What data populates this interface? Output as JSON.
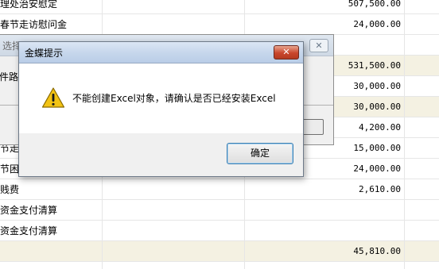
{
  "grid": {
    "rows": [
      {
        "name": "理处治安慰定",
        "amount": "507,500.00",
        "highlight": false
      },
      {
        "name": "春节走访慰问金",
        "amount": "24,000.00",
        "highlight": false
      },
      {
        "name": "",
        "amount": "",
        "highlight": false
      },
      {
        "name": "",
        "amount": "531,500.00",
        "highlight": true
      },
      {
        "name": "",
        "amount": "30,000.00",
        "highlight": false
      },
      {
        "name": "",
        "amount": "30,000.00",
        "highlight": true
      },
      {
        "name": "",
        "amount": "4,200.00",
        "highlight": false
      },
      {
        "name": "节走",
        "amount": "15,000.00",
        "highlight": false
      },
      {
        "name": "节困",
        "amount": "24,000.00",
        "highlight": false
      },
      {
        "name": "贱费",
        "amount": "2,610.00",
        "highlight": false
      },
      {
        "name": "资金支付清算",
        "amount": "",
        "highlight": false
      },
      {
        "name": "资金支付清算",
        "amount": "",
        "highlight": false
      },
      {
        "name": "",
        "amount": "45,810.00",
        "highlight": true
      }
    ]
  },
  "background_dialog": {
    "title": "选择",
    "close_label": "✕",
    "label": "件路"
  },
  "dialog": {
    "title": "金蝶提示",
    "close_label": "✕",
    "message": "不能创建Excel对象，请确认是否已经安装Excel",
    "icon": "warning-icon",
    "ok_label": "确定"
  },
  "colors": {
    "highlight_row": "#f4f1e2",
    "close_button": "#c9462c",
    "warning_fill": "#f2c314"
  }
}
